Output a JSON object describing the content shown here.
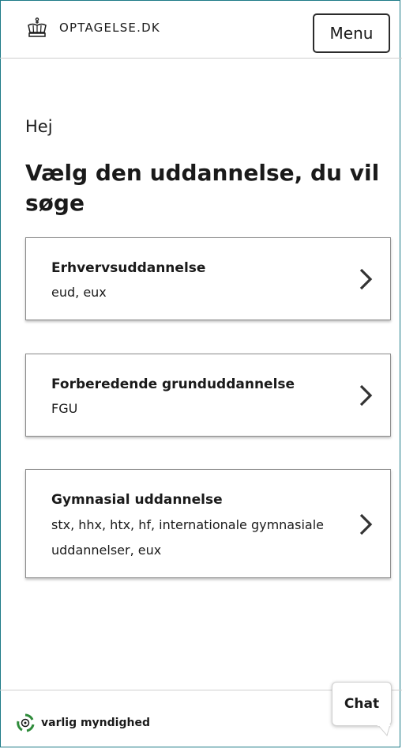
{
  "header": {
    "logo_text": "OPTAGELSE.DK",
    "menu_label": "Menu"
  },
  "main": {
    "greeting": "Hej",
    "heading": "Vælg den uddannelse, du vil søge",
    "cards": [
      {
        "title": "Erhvervsuddannelse",
        "subtitle": "eud, eux"
      },
      {
        "title": "Forberedende grunduddannelse",
        "subtitle": "FGU"
      },
      {
        "title": "Gymnasial uddannelse",
        "subtitle": "stx, hhx, htx, hf, internationale gymnasiale uddannelser, eux"
      }
    ]
  },
  "footer": {
    "text": "varlig myndighed"
  },
  "chat": {
    "label": "Chat"
  },
  "colors": {
    "accent_border": "#1d7a87",
    "text": "#1a1a1a",
    "card_border": "#8a8a8a",
    "footer_icon_green": "#2e8b3a"
  },
  "icons": [
    "crown-icon",
    "chevron-right-icon",
    "recycle-logo-icon"
  ]
}
